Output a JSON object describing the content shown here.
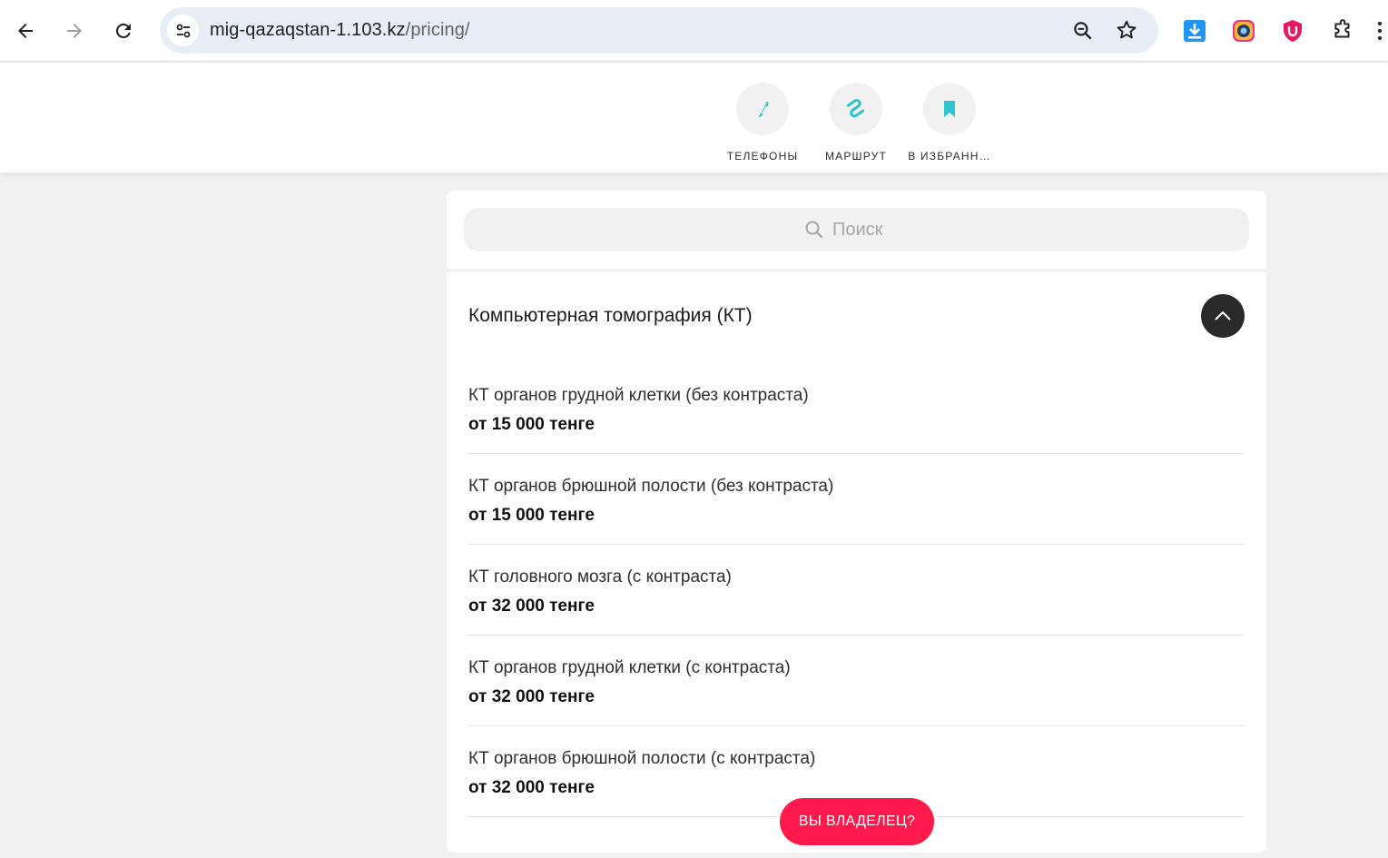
{
  "browser": {
    "url_host": "mig-qazaqstan-1.103.kz",
    "url_path": "/pricing/"
  },
  "header": {
    "actions": [
      {
        "label": "ТЕЛЕФОНЫ",
        "icon": "phone-icon"
      },
      {
        "label": "МАРШРУТ",
        "icon": "route-icon"
      },
      {
        "label": "В ИЗБРАНН…",
        "icon": "bookmark-icon"
      }
    ]
  },
  "search": {
    "placeholder": "Поиск"
  },
  "section": {
    "title": "Компьютерная томография (КТ)"
  },
  "items": [
    {
      "name": "КТ органов грудной клетки (без контраста)",
      "price": "от 15 000 тенге"
    },
    {
      "name": "КТ органов брюшной полости (без контраста)",
      "price": "от 15 000 тенге"
    },
    {
      "name": "КТ головного мозга (с контраста)",
      "price": "от 32 000 тенге"
    },
    {
      "name": "КТ органов грудной клетки (с контраста)",
      "price": "от 32 000 тенге"
    },
    {
      "name": "КТ органов брюшной полости (с контраста)",
      "price": "от 32 000 тенге"
    }
  ],
  "owner_button": "ВЫ ВЛАДЕЛЕЦ?",
  "colors": {
    "accent_teal": "#2ec4cf",
    "owner_red": "#ff1a4b",
    "dark_button": "#2a2a2a"
  }
}
